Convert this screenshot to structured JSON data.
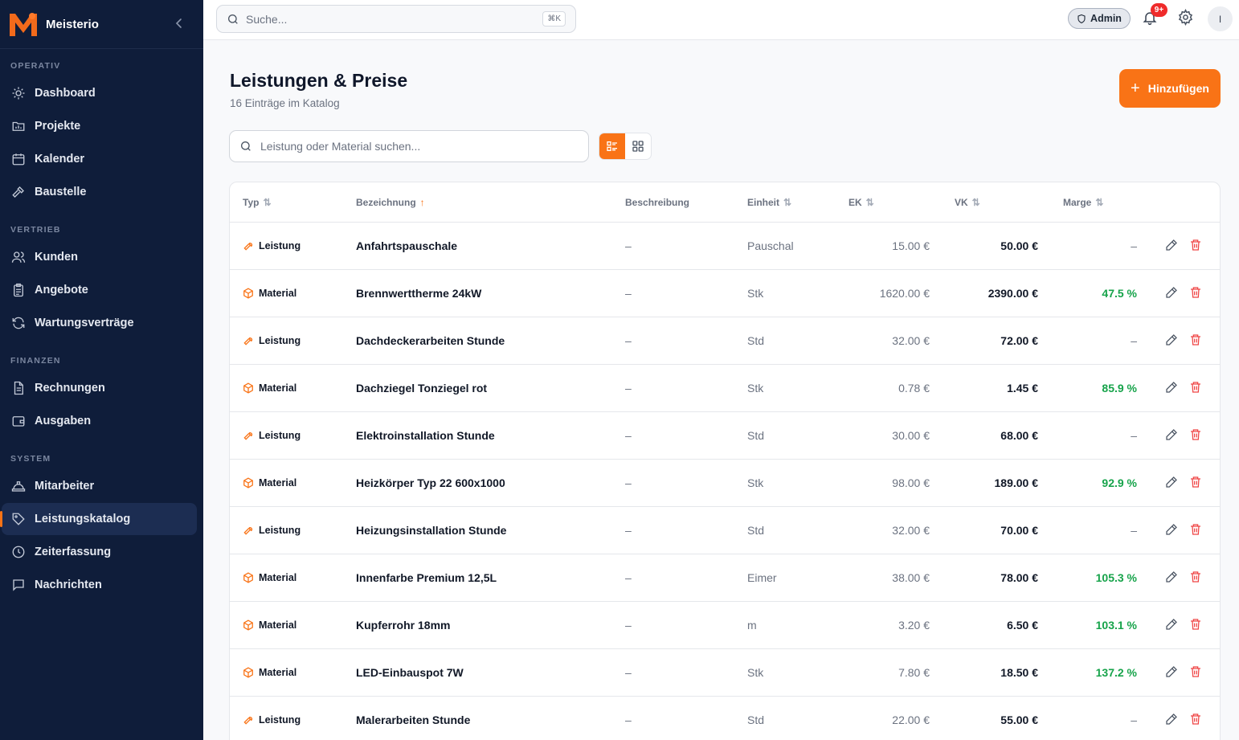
{
  "app": {
    "name": "Meisterio"
  },
  "sidebar": {
    "sections": [
      {
        "label": "OPERATIV",
        "items": [
          {
            "label": "Dashboard",
            "icon": "sun-icon"
          },
          {
            "label": "Projekte",
            "icon": "folder-chart-icon"
          },
          {
            "label": "Kalender",
            "icon": "calendar-icon"
          },
          {
            "label": "Baustelle",
            "icon": "hammer-icon"
          }
        ]
      },
      {
        "label": "VERTRIEB",
        "items": [
          {
            "label": "Kunden",
            "icon": "users-icon"
          },
          {
            "label": "Angebote",
            "icon": "clipboard-icon"
          },
          {
            "label": "Wartungsverträge",
            "icon": "refresh-icon"
          }
        ]
      },
      {
        "label": "FINANZEN",
        "items": [
          {
            "label": "Rechnungen",
            "icon": "file-text-icon"
          },
          {
            "label": "Ausgaben",
            "icon": "wallet-icon"
          }
        ]
      },
      {
        "label": "SYSTEM",
        "items": [
          {
            "label": "Mitarbeiter",
            "icon": "hard-hat-icon"
          },
          {
            "label": "Leistungskatalog",
            "icon": "tag-icon",
            "active": true
          },
          {
            "label": "Zeiterfassung",
            "icon": "clock-icon"
          },
          {
            "label": "Nachrichten",
            "icon": "message-icon"
          }
        ]
      }
    ]
  },
  "topbar": {
    "search_placeholder": "Suche...",
    "shortcut": "⌘K",
    "role": "Admin",
    "notifications": "9+",
    "avatar_initial": "I"
  },
  "page": {
    "title": "Leistungen & Preise",
    "subtitle": "16 Einträge im Katalog",
    "add_label": "Hinzufügen",
    "search_placeholder": "Leistung oder Material suchen..."
  },
  "table": {
    "columns": {
      "typ": "Typ",
      "bezeichnung": "Bezeichnung",
      "beschreibung": "Beschreibung",
      "einheit": "Einheit",
      "ek": "EK",
      "vk": "VK",
      "marge": "Marge"
    },
    "rows": [
      {
        "type": "Leistung",
        "name": "Anfahrtspauschale",
        "desc": "–",
        "unit": "Pauschal",
        "ek": "15.00 €",
        "vk": "50.00 €",
        "marge": "–"
      },
      {
        "type": "Material",
        "name": "Brennwerttherme 24kW",
        "desc": "–",
        "unit": "Stk",
        "ek": "1620.00 €",
        "vk": "2390.00 €",
        "marge": "47.5 %"
      },
      {
        "type": "Leistung",
        "name": "Dachdeckerarbeiten Stunde",
        "desc": "–",
        "unit": "Std",
        "ek": "32.00 €",
        "vk": "72.00 €",
        "marge": "–"
      },
      {
        "type": "Material",
        "name": "Dachziegel Tonziegel rot",
        "desc": "–",
        "unit": "Stk",
        "ek": "0.78 €",
        "vk": "1.45 €",
        "marge": "85.9 %"
      },
      {
        "type": "Leistung",
        "name": "Elektroinstallation Stunde",
        "desc": "–",
        "unit": "Std",
        "ek": "30.00 €",
        "vk": "68.00 €",
        "marge": "–"
      },
      {
        "type": "Material",
        "name": "Heizkörper Typ 22 600x1000",
        "desc": "–",
        "unit": "Stk",
        "ek": "98.00 €",
        "vk": "189.00 €",
        "marge": "92.9 %"
      },
      {
        "type": "Leistung",
        "name": "Heizungsinstallation Stunde",
        "desc": "–",
        "unit": "Std",
        "ek": "32.00 €",
        "vk": "70.00 €",
        "marge": "–"
      },
      {
        "type": "Material",
        "name": "Innenfarbe Premium 12,5L",
        "desc": "–",
        "unit": "Eimer",
        "ek": "38.00 €",
        "vk": "78.00 €",
        "marge": "105.3 %"
      },
      {
        "type": "Material",
        "name": "Kupferrohr 18mm",
        "desc": "–",
        "unit": "m",
        "ek": "3.20 €",
        "vk": "6.50 €",
        "marge": "103.1 %"
      },
      {
        "type": "Material",
        "name": "LED-Einbauspot 7W",
        "desc": "–",
        "unit": "Stk",
        "ek": "7.80 €",
        "vk": "18.50 €",
        "marge": "137.2 %"
      },
      {
        "type": "Leistung",
        "name": "Malerarbeiten Stunde",
        "desc": "–",
        "unit": "Std",
        "ek": "22.00 €",
        "vk": "55.00 €",
        "marge": "–"
      }
    ]
  },
  "colors": {
    "accent": "#f97316",
    "sidebar": "#0f1d3a",
    "positive": "#16a34a",
    "danger": "#ef4444"
  }
}
